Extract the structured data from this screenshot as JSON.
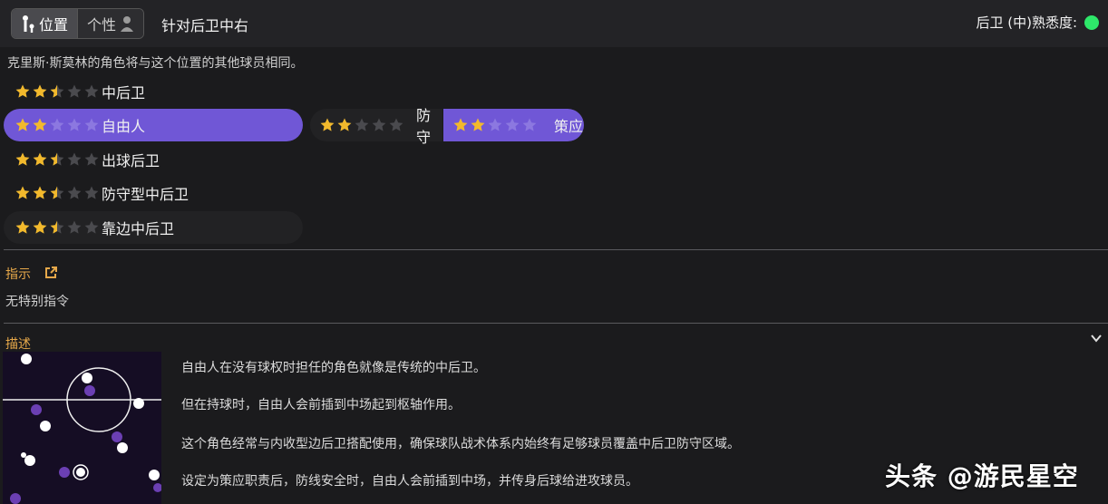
{
  "tabs": [
    {
      "label": "位置",
      "icon": "position-icon",
      "active": true
    },
    {
      "label": "个性",
      "icon": "person-icon",
      "active": false
    }
  ],
  "header": {
    "title": "针对后卫中右",
    "familiarity_label": "后卫 (中)熟悉度:",
    "familiarity_color": "#2ee86a"
  },
  "subtitle": "克里斯·斯莫林的角色将与这个位置的其他球员相同。",
  "roles": [
    {
      "label": "中后卫",
      "rating": 2.5,
      "selected": false
    },
    {
      "label": "自由人",
      "rating": 2,
      "selected": true
    },
    {
      "label": "出球后卫",
      "rating": 2.5,
      "selected": false
    },
    {
      "label": "防守型中后卫",
      "rating": 2.5,
      "selected": false
    },
    {
      "label": "靠边中后卫",
      "rating": 2.5,
      "selected": false
    }
  ],
  "duties": [
    {
      "label": "防守",
      "rating": 2,
      "selected": false
    },
    {
      "label": "策应",
      "rating": 2,
      "selected": true
    }
  ],
  "instructions": {
    "title": "指示",
    "text": "无特别指令"
  },
  "description": {
    "title": "描述",
    "lines": [
      "自由人在没有球权时担任的角色就像是传统的中后卫。",
      "但在持球时，自由人会前插到中场起到枢轴作用。",
      "这个角色经常与内收型边后卫搭配使用，确保球队战术体系内始终有足够球员覆盖中后卫防守区域。",
      "设定为策应职责后，防线安全时，自由人会前插到中场，并传身后球给进攻球员。"
    ]
  },
  "colors": {
    "accent": "#7057d6",
    "star_filled": "#f2b92c",
    "star_empty": "#4a4a4e",
    "section_title": "#e6a84a"
  },
  "watermark": "头条 @游民星空"
}
